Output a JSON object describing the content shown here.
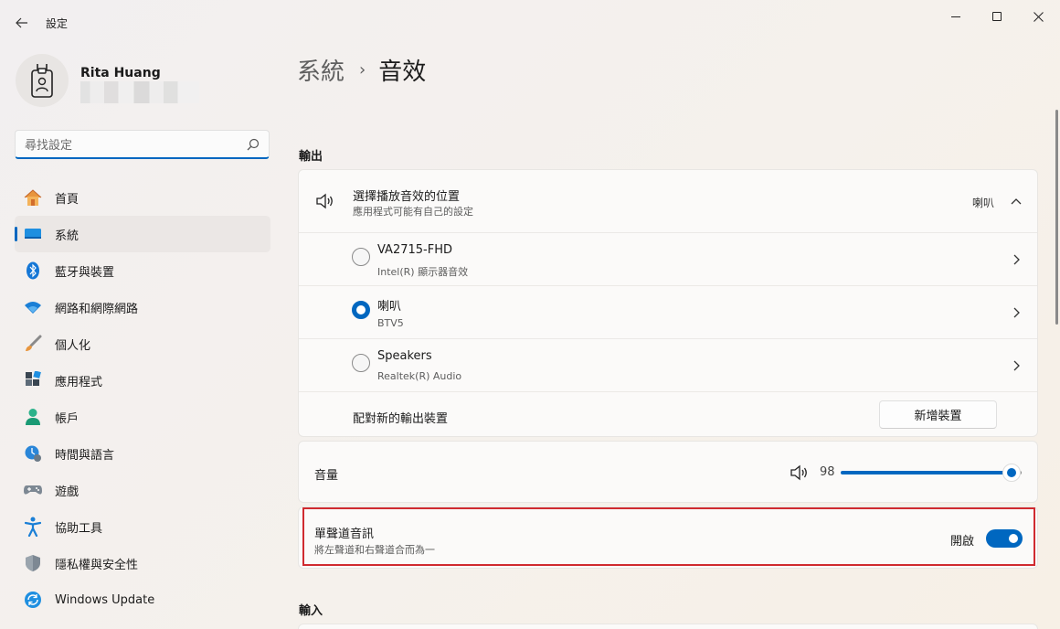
{
  "window": {
    "title": "設定"
  },
  "user": {
    "name": "Rita Huang"
  },
  "search": {
    "placeholder": "尋找設定"
  },
  "nav": [
    {
      "label": "首頁",
      "icon": "home-icon"
    },
    {
      "label": "系統",
      "icon": "system-icon",
      "active": true
    },
    {
      "label": "藍牙與裝置",
      "icon": "bluetooth-icon"
    },
    {
      "label": "網路和網際網路",
      "icon": "wifi-icon"
    },
    {
      "label": "個人化",
      "icon": "brush-icon"
    },
    {
      "label": "應用程式",
      "icon": "apps-icon"
    },
    {
      "label": "帳戶",
      "icon": "account-icon"
    },
    {
      "label": "時間與語言",
      "icon": "clock-globe-icon"
    },
    {
      "label": "遊戲",
      "icon": "gamepad-icon"
    },
    {
      "label": "協助工具",
      "icon": "accessibility-icon"
    },
    {
      "label": "隱私權與安全性",
      "icon": "shield-icon"
    },
    {
      "label": "Windows Update",
      "icon": "update-icon"
    }
  ],
  "breadcrumb": {
    "parent": "系統",
    "separator": "›",
    "current": "音效"
  },
  "output": {
    "heading": "輸出",
    "choose": {
      "title": "選擇播放音效的位置",
      "subtitle": "應用程式可能有自己的設定",
      "value": "喇叭"
    },
    "devices": [
      {
        "name": "VA2715-FHD",
        "detail": "Intel(R) 顯示器音效",
        "selected": false
      },
      {
        "name": "喇叭",
        "detail": "BTV5",
        "selected": true
      },
      {
        "name": "Speakers",
        "detail": "Realtek(R) Audio",
        "selected": false
      }
    ],
    "pair": {
      "label": "配對新的輸出裝置",
      "button": "新增裝置"
    },
    "volume": {
      "label": "音量",
      "value": "98",
      "level": 0.98
    },
    "mono": {
      "title": "單聲道音訊",
      "subtitle": "將左聲道和右聲道合而為一",
      "state_label": "開啟",
      "on": true
    }
  },
  "input": {
    "heading": "輸入"
  },
  "colors": {
    "accent": "#0067c0",
    "highlight": "#d02a2f"
  }
}
